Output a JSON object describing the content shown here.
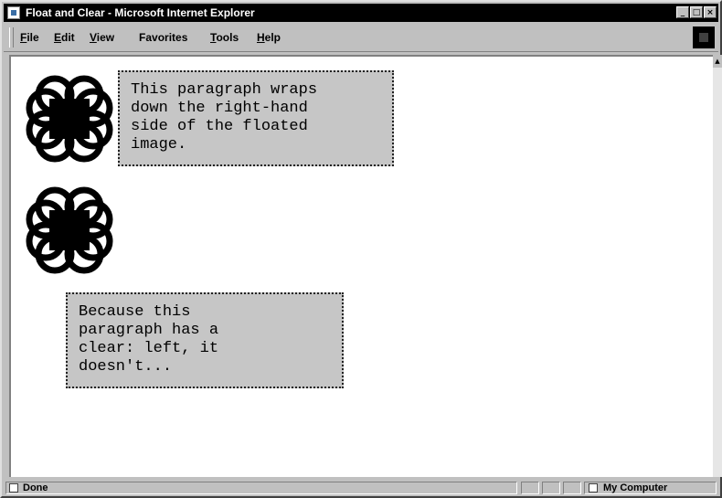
{
  "window": {
    "title": "Float and Clear - Microsoft Internet Explorer"
  },
  "menu": {
    "items": [
      {
        "underline": "F",
        "rest": "ile"
      },
      {
        "underline": "E",
        "rest": "dit"
      },
      {
        "underline": "V",
        "rest": "iew"
      },
      {
        "underline": "Fa",
        "rest": "vorites"
      },
      {
        "underline": "T",
        "rest": "ools"
      },
      {
        "underline": "H",
        "rest": "elp"
      }
    ]
  },
  "page": {
    "paragraph1": "This paragraph wraps\ndown the right-hand\nside of the floated\nimage.",
    "paragraph2": "Because this\nparagraph has a\nclear: left, it\ndoesn't..."
  },
  "status": {
    "left": "Done",
    "zone": "My Computer"
  },
  "icons": {
    "app": "ie-page-icon",
    "logo": "interlocking-rings-icon",
    "throbber": "windows-throbber-icon",
    "zone": "computer-icon"
  }
}
